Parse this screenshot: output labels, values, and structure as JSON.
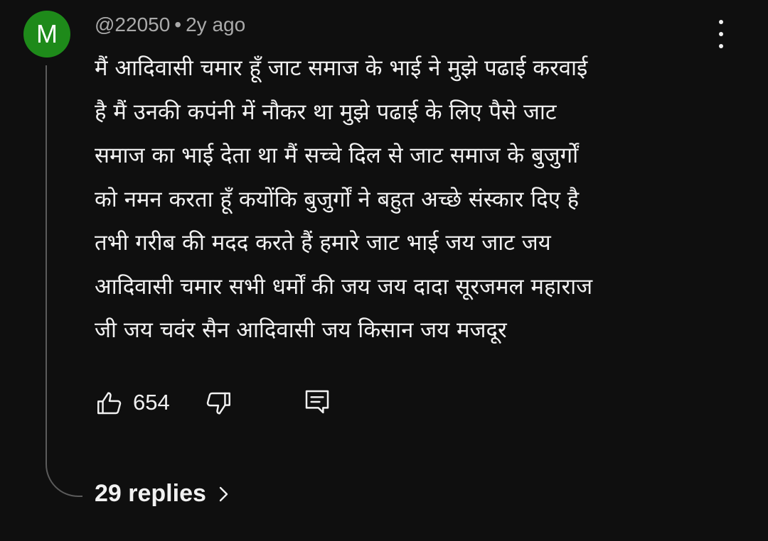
{
  "comment": {
    "avatar_letter": "M",
    "avatar_color": "#1e8a1a",
    "author": "@22050",
    "separator": "•",
    "time": "2y ago",
    "lines": [
      "मैं आदिवासी चमार हूँ जाट समाज के भाई ने मुझे पढाई करवाई",
      "है मैं उनकी कपंनी में नौकर था मुझे पढाई के लिए पैसे जाट",
      "समाज का भाई देता था मैं सच्चे दिल से जाट समाज के बुजुर्गों",
      "को नमन करता हूँ कयोंकि बुजुर्गों ने बहुत अच्छे संस्कार दिए है",
      "तभी गरीब की मदद करते हैं हमारे जाट भाई जय जाट जय",
      "आदिवासी चमार सभी धर्मों की जय जय दादा सूरजमल महाराज",
      "जी जय चवंर सैन आदिवासी जय किसान जय मजदूर"
    ],
    "likes": "654",
    "replies_label": "29 replies"
  },
  "icons": {
    "menu": "more-vert-icon",
    "like": "thumbs-up-icon",
    "dislike": "thumbs-down-icon",
    "reply": "reply-comment-icon",
    "expand": "chevron-right-icon"
  },
  "colors": {
    "background": "#0f0f0f",
    "text": "#f1f1f1",
    "meta": "#aaaaaa",
    "thread_line": "#5b5b5b"
  }
}
